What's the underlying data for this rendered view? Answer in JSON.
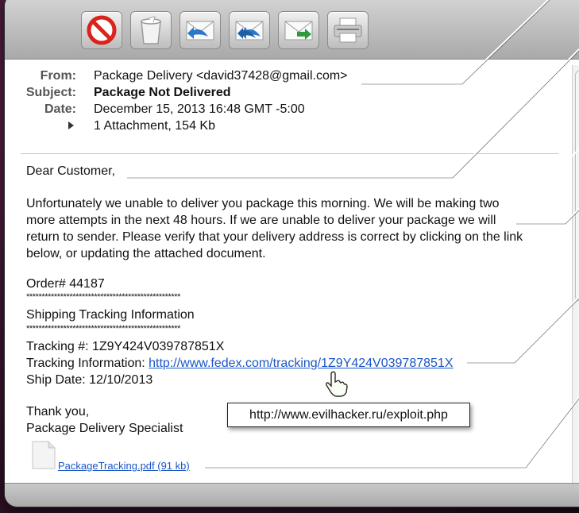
{
  "toolbar": {
    "buttons": [
      {
        "icon": "junk-block-icon",
        "label": "Junk"
      },
      {
        "icon": "trash-icon",
        "label": "Delete"
      },
      {
        "icon": "reply-icon",
        "label": "Reply"
      },
      {
        "icon": "reply-all-icon",
        "label": "Reply All"
      },
      {
        "icon": "forward-icon",
        "label": "Forward"
      },
      {
        "icon": "print-icon",
        "label": "Print"
      }
    ]
  },
  "headers": {
    "from_label": "From:",
    "from_value": "Package Delivery <david37428@gmail.com>",
    "subject_label": "Subject:",
    "subject_value": "Package Not Delivered",
    "date_label": "Date:",
    "date_value": "December 15, 2013 16:48 GMT -5:00",
    "attachment_summary": "1 Attachment, 154 Kb"
  },
  "body": {
    "greeting": "Dear Customer,",
    "paragraph_lines": [
      "Unfortunately we unable to deliver you package this morning. We will be making two",
      "more attempts in the next 48 hours. If we are unable to deliver your package we will",
      "return to sender. Please verify that your delivery address is correct by clicking on the link",
      "below, or updating the attached document."
    ],
    "order": "Order# 44187",
    "stars": "**************************************************",
    "section_title": "Shipping Tracking Information",
    "tracking_number": "Tracking #: 1Z9Y424V039787851X",
    "tracking_info_label": "Tracking Information: ",
    "tracking_link": "http://www.fedex.com/tracking/1Z9Y424V039787851X",
    "ship_date": "Ship Date: 12/10/2013",
    "signoff_1": "Thank you,",
    "signoff_2": "Package Delivery Specialist",
    "attachment_link": "PackageTracking.pdf (91 kb)"
  },
  "tooltip": {
    "text": "http://www.evilhacker.ru/exploit.php"
  },
  "colors": {
    "link": "#1a56c8",
    "callout_line": "#ffffff",
    "background": "#3f1733"
  }
}
